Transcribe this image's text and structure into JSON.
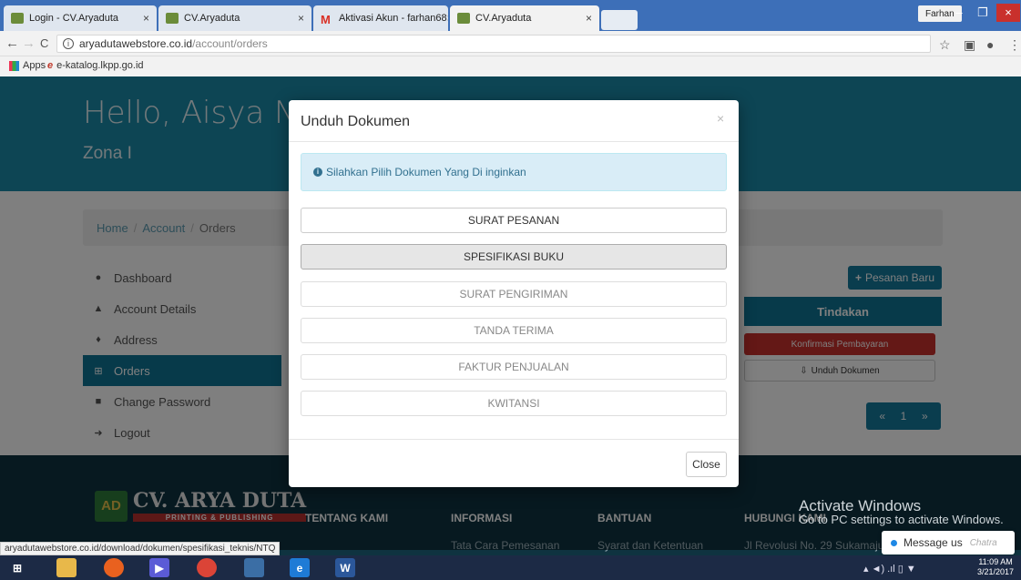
{
  "browser": {
    "tabs": [
      {
        "title": "Login - CV.Aryaduta"
      },
      {
        "title": "CV.Aryaduta"
      },
      {
        "title": "Aktivasi Akun - farhan68"
      },
      {
        "title": "CV.Aryaduta"
      }
    ],
    "profile": "Farhan",
    "url_domain": "aryadutawebstore.co.id",
    "url_path": "/account/orders",
    "bookmarks": [
      {
        "label": "Apps"
      },
      {
        "label": "e-katalog.lkpp.go.id"
      }
    ]
  },
  "hero": {
    "greeting": "Hello, Aisya Nu",
    "zone": "Zona I"
  },
  "breadcrumb": {
    "home": "Home",
    "account": "Account",
    "current": "Orders"
  },
  "sidebar": {
    "items": [
      {
        "label": "Dashboard",
        "icon": "tachometer-icon"
      },
      {
        "label": "Account Details",
        "icon": "user-icon"
      },
      {
        "label": "Address",
        "icon": "map-marker-icon"
      },
      {
        "label": "Orders",
        "icon": "cart-icon"
      },
      {
        "label": "Change Password",
        "icon": "lock-icon"
      },
      {
        "label": "Logout",
        "icon": "sign-out-icon"
      }
    ]
  },
  "orders": {
    "new_order_label": "Pesanan Baru",
    "actions_header": "Tindakan",
    "confirm_payment_label": "Konfirmasi Pembayaran",
    "download_label": "Unduh Dokumen",
    "pager": {
      "prev": "«",
      "page": "1",
      "next": "»"
    }
  },
  "footer": {
    "brand": "CV. ARYA DUTA",
    "brand_sub": "PRINTING & PUBLISHING",
    "columns": [
      {
        "title": "TENTANG KAMI",
        "link": ""
      },
      {
        "title": "INFORMASI",
        "link": "Tata Cara Pemesanan"
      },
      {
        "title": "BANTUAN",
        "link": "Syarat dan Ketentuan"
      },
      {
        "title": "HUBUNGI KAMI",
        "link": "Jl Revolusi No. 29 Sukamaju"
      }
    ]
  },
  "modal": {
    "title": "Unduh Dokumen",
    "close_x": "×",
    "alert": "Silahkan Pilih Dokumen Yang Di inginkan",
    "documents": [
      {
        "label": "SURAT PESANAN"
      },
      {
        "label": "SPESIFIKASI BUKU"
      },
      {
        "label": "SURAT PENGIRIMAN"
      },
      {
        "label": "TANDA TERIMA"
      },
      {
        "label": "FAKTUR PENJUALAN"
      },
      {
        "label": "KWITANSI"
      }
    ],
    "close_button": "Close"
  },
  "status_url": "aryadutawebstore.co.id/download/dokumen/spesifikasi_teknis/NTQ",
  "windows_watermark": {
    "title": "Activate Windows",
    "subtitle": "Go to PC settings to activate Windows."
  },
  "chat": {
    "label": "Message us",
    "brand": "Chatra"
  },
  "taskbar": {
    "time": "11:09 AM",
    "date": "3/21/2017"
  },
  "colors": {
    "primary": "#1a8aa9",
    "nav_active": "#0e7594",
    "danger": "#c9302c",
    "footer": "#0f3340"
  }
}
